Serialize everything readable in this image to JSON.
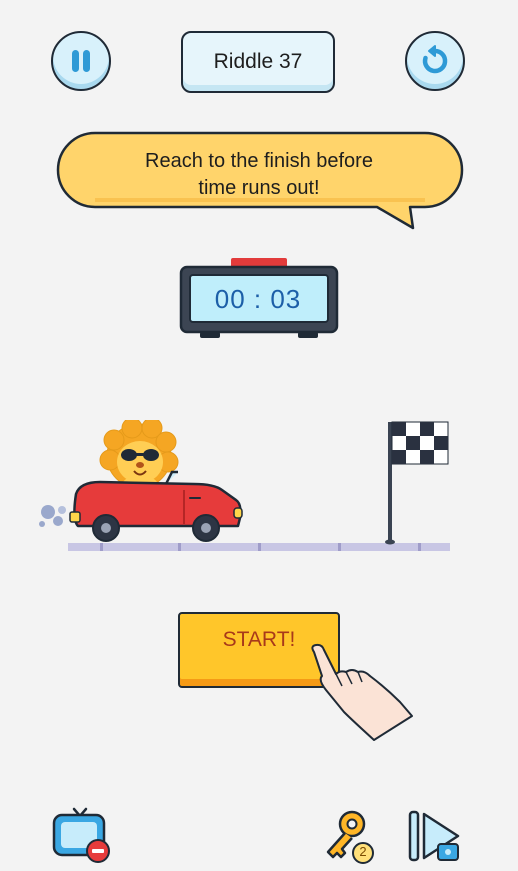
{
  "header": {
    "title": "Riddle 37",
    "pause_icon": "pause-icon",
    "restart_icon": "restart-icon"
  },
  "hint": {
    "line1": "Reach to the finish before",
    "line2": "time runs out!"
  },
  "timer": {
    "display": "00 : 03"
  },
  "scene": {
    "character": "lion-in-red-car",
    "goal": "checkered-finish-flag"
  },
  "start_button": {
    "label": "START!"
  },
  "footer": {
    "tv_icon": "no-ads-tv-icon",
    "key_icon": "hint-key-icon",
    "key_count": "2",
    "skip_icon": "skip-video-icon"
  },
  "colors": {
    "background": "#f3f3f3",
    "bubble": "#ffd46b",
    "accent_blue": "#2e9ad6",
    "car_red": "#e63b3b",
    "start_yellow": "#ffc62a"
  }
}
